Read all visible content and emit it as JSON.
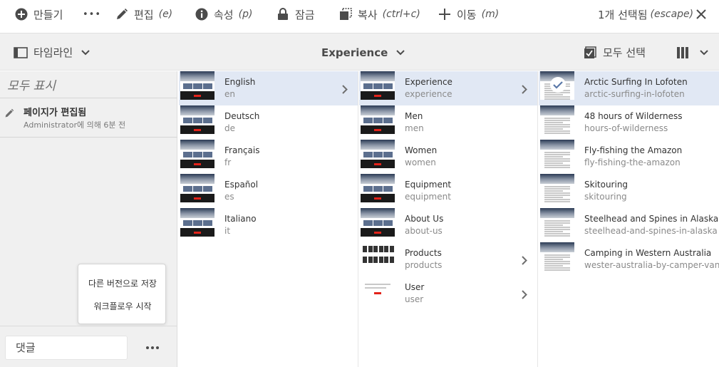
{
  "actionbar": {
    "create": "만들기",
    "more": "•••",
    "edit": "편집",
    "edit_sc": "(e)",
    "props": "속성",
    "props_sc": "(p)",
    "lock": "잠금",
    "copy": "복사",
    "copy_sc": "(ctrl+c)",
    "move": "이동",
    "move_sc": "(m)",
    "selected": "1개 선택됨",
    "selected_sc": "(escape)"
  },
  "nav": {
    "rail_toggle": "타임라인",
    "title": "Experience",
    "select_all": "모두 선택"
  },
  "rail": {
    "show_all": "모두 표시",
    "event_title": "페이지가 편집됨",
    "event_sub": "Administrator에 의해 6분 전",
    "popover": {
      "save_version": "다른 버전으로 저장",
      "start_workflow": "워크플로우 시작"
    },
    "comment_placeholder": "댓글"
  },
  "columns": [
    {
      "items": [
        {
          "title": "English",
          "name": "en",
          "selected": true,
          "has_children": true
        },
        {
          "title": "Deutsch",
          "name": "de",
          "selected": false,
          "has_children": false
        },
        {
          "title": "Français",
          "name": "fr",
          "selected": false,
          "has_children": false
        },
        {
          "title": "Español",
          "name": "es",
          "selected": false,
          "has_children": false
        },
        {
          "title": "Italiano",
          "name": "it",
          "selected": false,
          "has_children": false
        }
      ]
    },
    {
      "items": [
        {
          "title": "Experience",
          "name": "experience",
          "selected": true,
          "has_children": true
        },
        {
          "title": "Men",
          "name": "men",
          "selected": false,
          "has_children": false
        },
        {
          "title": "Women",
          "name": "women",
          "selected": false,
          "has_children": false
        },
        {
          "title": "Equipment",
          "name": "equipment",
          "selected": false,
          "has_children": false
        },
        {
          "title": "About Us",
          "name": "about-us",
          "selected": false,
          "has_children": false
        },
        {
          "title": "Products",
          "name": "products",
          "selected": false,
          "has_children": true
        },
        {
          "title": "User",
          "name": "user",
          "selected": false,
          "has_children": true
        }
      ]
    },
    {
      "items": [
        {
          "title": "Arctic Surfing In Lofoten",
          "name": "arctic-surfing-in-lofoten",
          "selected": true,
          "has_children": false
        },
        {
          "title": "48 hours of Wilderness",
          "name": "hours-of-wilderness",
          "selected": false,
          "has_children": false
        },
        {
          "title": "Fly-fishing the Amazon",
          "name": "fly-fishing-the-amazon",
          "selected": false,
          "has_children": false
        },
        {
          "title": "Skitouring",
          "name": "skitouring",
          "selected": false,
          "has_children": false
        },
        {
          "title": "Steelhead and Spines in Alaska",
          "name": "steelhead-and-spines-in-alaska",
          "selected": false,
          "has_children": false
        },
        {
          "title": "Camping in Western Australia",
          "name": "wester-australia-by-camper-van",
          "selected": false,
          "has_children": false
        }
      ]
    }
  ],
  "colors": {
    "selected_row": "#e1e8f4",
    "rail_bg": "#f0f0f0",
    "text": "#4b4b4b"
  }
}
